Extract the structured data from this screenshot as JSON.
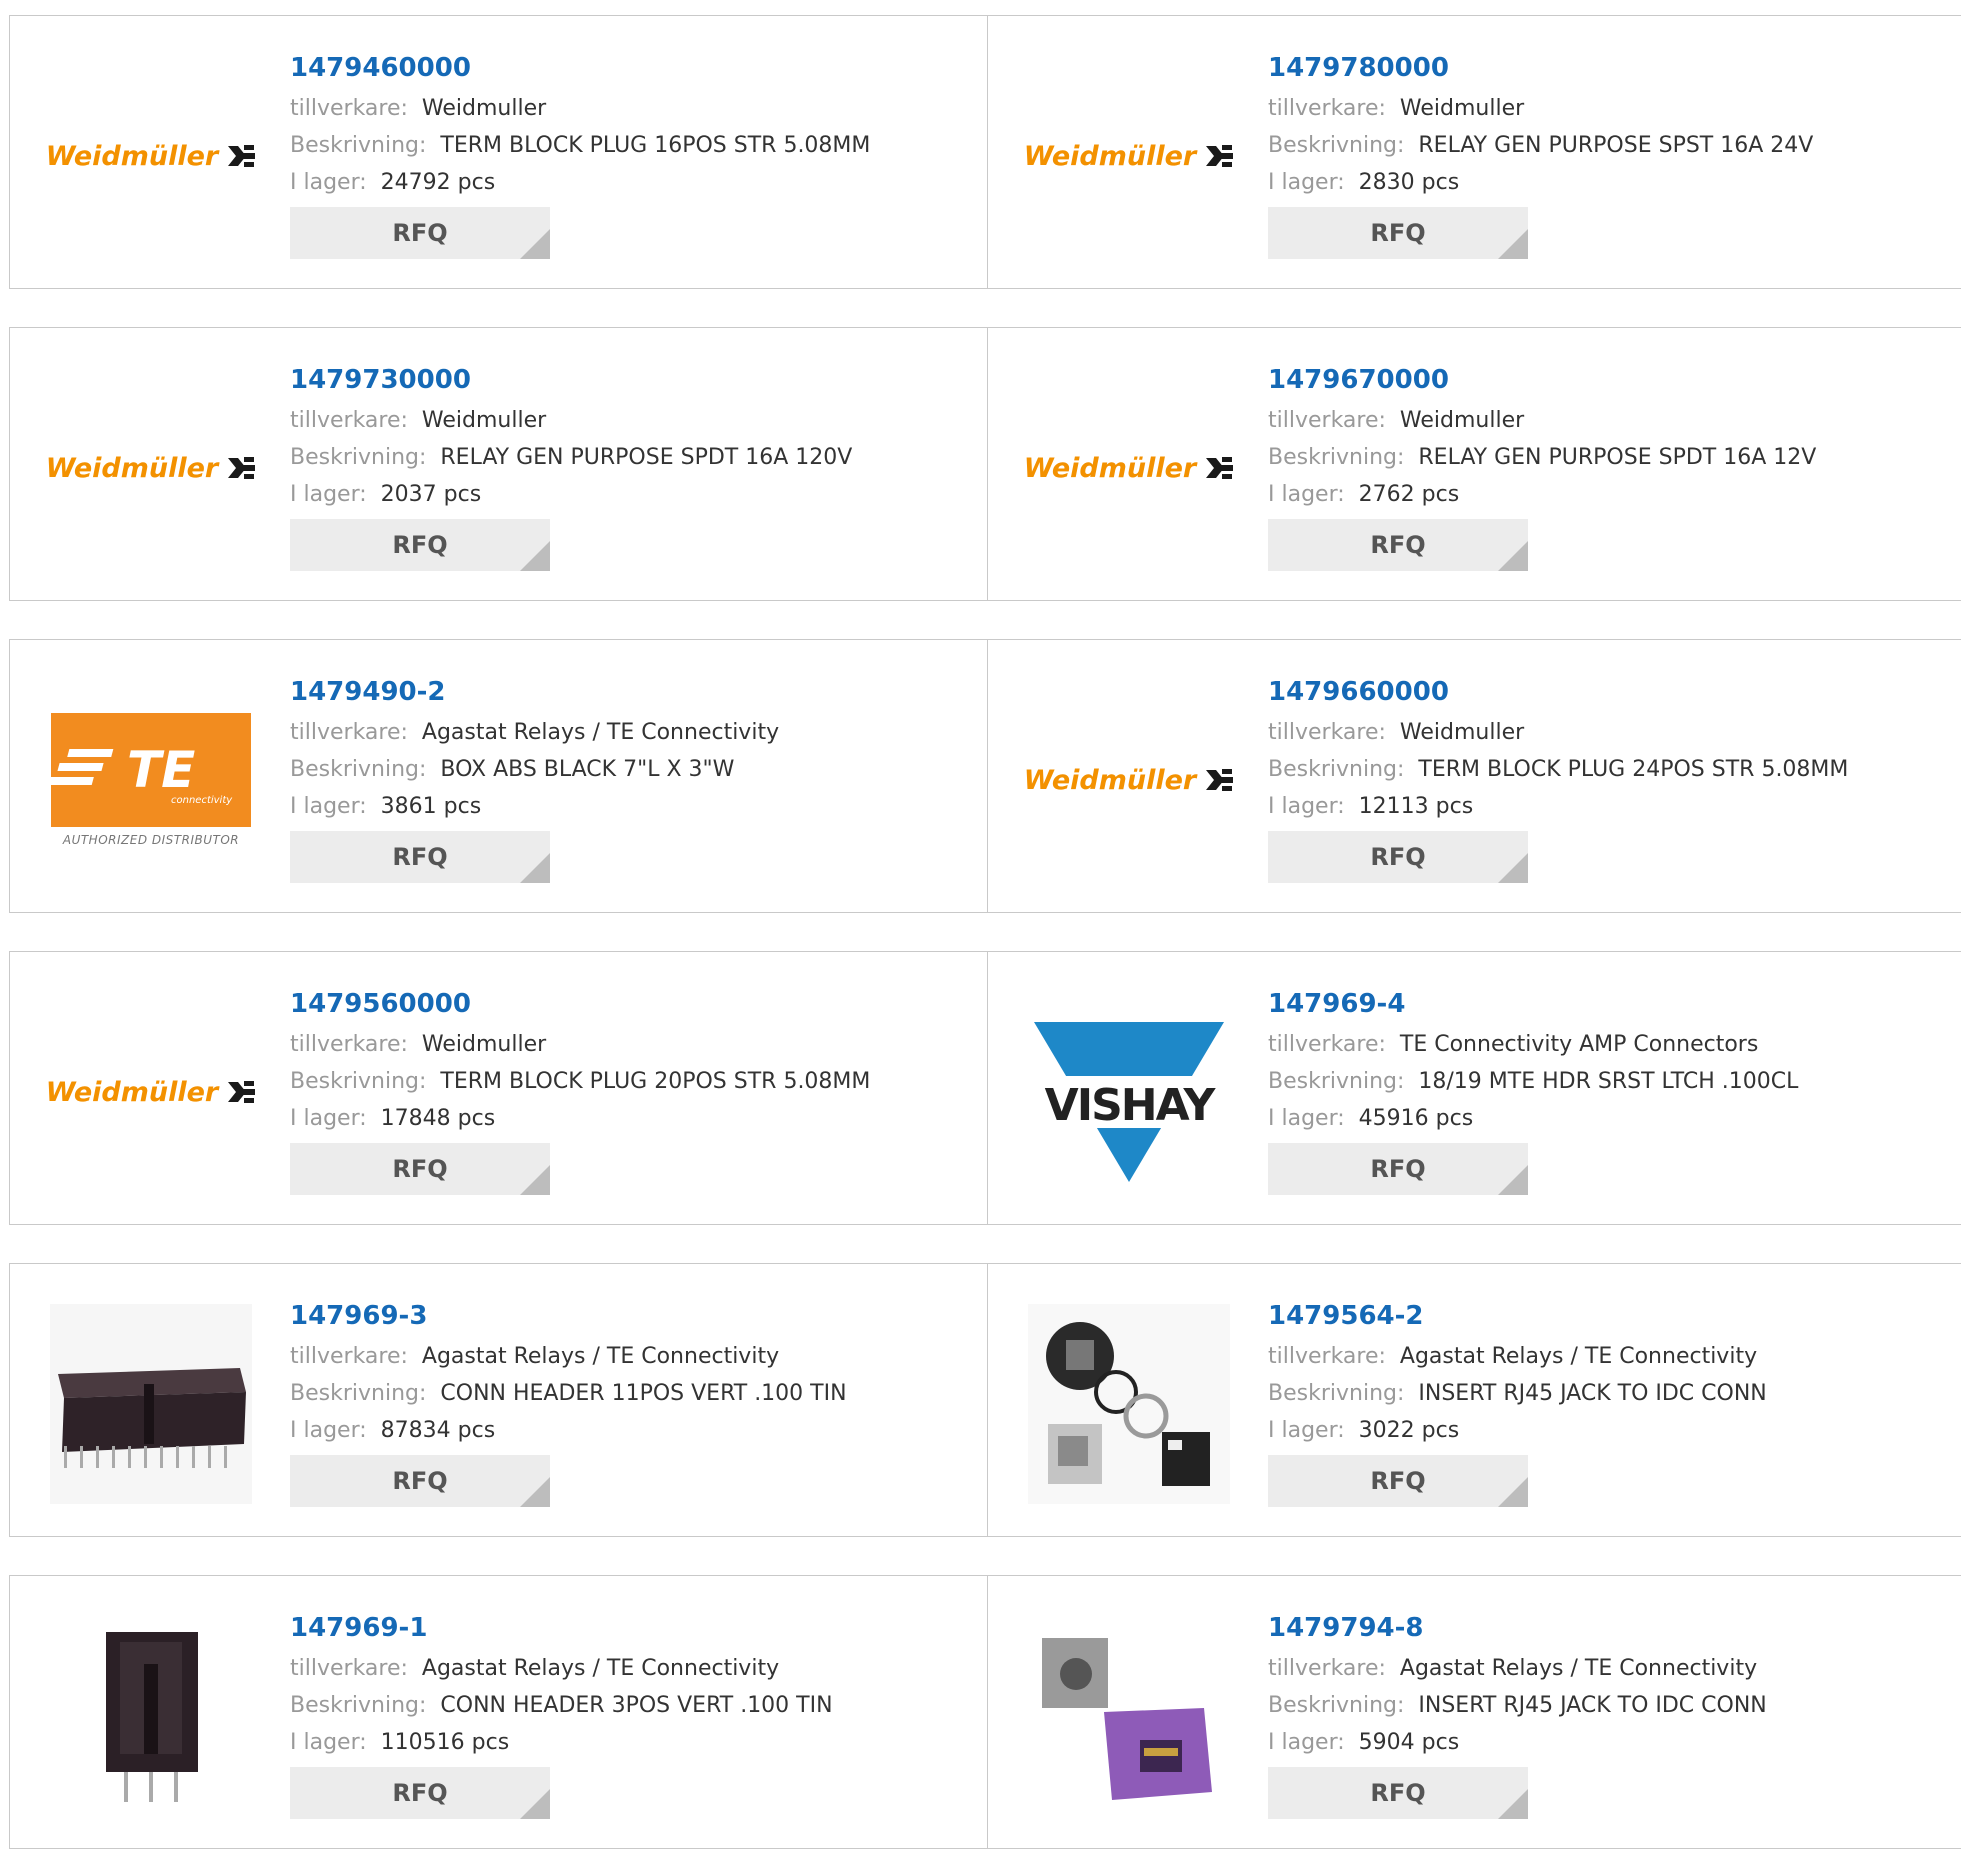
{
  "labels": {
    "manufacturer": "tillverkare:",
    "description": "Beskrivning:",
    "stock": "I lager:",
    "rfq": "RFQ"
  },
  "logos": {
    "weidmuller_text": "Weidmüller",
    "te_connectivity_sub": "connectivity",
    "te_authorized": "AUTHORIZED DISTRIBUTOR",
    "vishay_text": "VISHAY"
  },
  "colors": {
    "part_link": "#1569b6",
    "weidmuller_orange": "#f39100",
    "te_orange": "#f28c1f",
    "vishay_blue": "#1e88c8",
    "rfq_bg": "#ececec"
  },
  "products": [
    {
      "part": "1479460000",
      "manufacturer": "Weidmuller",
      "description": "TERM BLOCK PLUG 16POS STR 5.08MM",
      "stock": "24792 pcs",
      "image": "weidmuller-logo"
    },
    {
      "part": "1479780000",
      "manufacturer": "Weidmuller",
      "description": "RELAY GEN PURPOSE SPST 16A 24V",
      "stock": "2830 pcs",
      "image": "weidmuller-logo"
    },
    {
      "part": "1479730000",
      "manufacturer": "Weidmuller",
      "description": "RELAY GEN PURPOSE SPDT 16A 120V",
      "stock": "2037 pcs",
      "image": "weidmuller-logo"
    },
    {
      "part": "1479670000",
      "manufacturer": "Weidmuller",
      "description": "RELAY GEN PURPOSE SPDT 16A 12V",
      "stock": "2762 pcs",
      "image": "weidmuller-logo"
    },
    {
      "part": "1479490-2",
      "manufacturer": "Agastat Relays / TE Connectivity",
      "description": "BOX ABS BLACK 7\"L X 3\"W",
      "stock": "3861 pcs",
      "image": "te-connectivity-logo"
    },
    {
      "part": "1479660000",
      "manufacturer": "Weidmuller",
      "description": "TERM BLOCK PLUG 24POS STR 5.08MM",
      "stock": "12113 pcs",
      "image": "weidmuller-logo"
    },
    {
      "part": "1479560000",
      "manufacturer": "Weidmuller",
      "description": "TERM BLOCK PLUG 20POS STR 5.08MM",
      "stock": "17848 pcs",
      "image": "weidmuller-logo"
    },
    {
      "part": "147969-4",
      "manufacturer": "TE Connectivity AMP Connectors",
      "description": "18/19 MTE HDR SRST LTCH .100CL",
      "stock": "45916 pcs",
      "image": "vishay-logo"
    },
    {
      "part": "147969-3",
      "manufacturer": "Agastat Relays / TE Connectivity",
      "description": "CONN HEADER 11POS VERT .100 TIN",
      "stock": "87834 pcs",
      "image": "header-11pos-photo"
    },
    {
      "part": "1479564-2",
      "manufacturer": "Agastat Relays / TE Connectivity",
      "description": "INSERT RJ45 JACK TO IDC CONN",
      "stock": "3022 pcs",
      "image": "rj45-insert-kit-photo"
    },
    {
      "part": "147969-1",
      "manufacturer": "Agastat Relays / TE Connectivity",
      "description": "CONN HEADER 3POS VERT .100 TIN",
      "stock": "110516 pcs",
      "image": "header-3pos-photo"
    },
    {
      "part": "1479794-8",
      "manufacturer": "Agastat Relays / TE Connectivity",
      "description": "INSERT RJ45 JACK TO IDC CONN",
      "stock": "5904 pcs",
      "image": "rj45-purple-jack-photo"
    }
  ]
}
